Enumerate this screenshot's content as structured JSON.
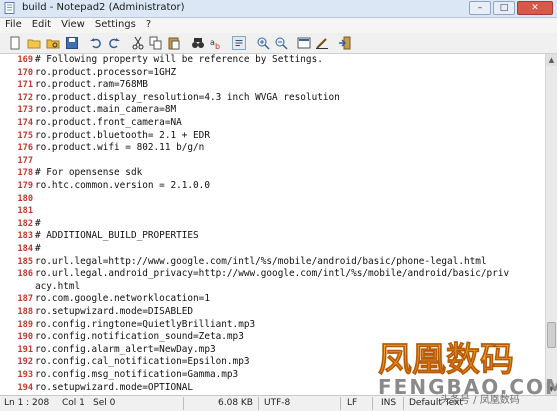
{
  "window": {
    "title": "build - Notepad2 (Administrator)",
    "min": "–",
    "max": "□",
    "close": "✕"
  },
  "menu": [
    "File",
    "Edit",
    "View",
    "Settings",
    "?"
  ],
  "toolbar": [
    "new-file-icon",
    "open-folder-icon",
    "browse-icon",
    "save-icon",
    "undo-icon",
    "redo-icon",
    "cut-icon",
    "copy-icon",
    "paste-icon",
    "find-icon",
    "replace-icon",
    "word-wrap-icon",
    "zoom-in-icon",
    "zoom-out-icon",
    "scheme-icon",
    "customize-icon",
    "exit-icon"
  ],
  "lines": [
    {
      "n": "169",
      "t": "# Following property will be reference by Settings."
    },
    {
      "n": "170",
      "t": "ro.product.processor=1GHZ"
    },
    {
      "n": "171",
      "t": "ro.product.ram=768MB"
    },
    {
      "n": "172",
      "t": "ro.product.display_resolution=4.3 inch WVGA resolution"
    },
    {
      "n": "173",
      "t": "ro.product.main_camera=8M"
    },
    {
      "n": "174",
      "t": "ro.product.front_camera=NA"
    },
    {
      "n": "175",
      "t": "ro.product.bluetooth= 2.1 + EDR"
    },
    {
      "n": "176",
      "t": "ro.product.wifi = 802.11 b/g/n"
    },
    {
      "n": "177",
      "t": ""
    },
    {
      "n": "178",
      "t": "# For opensense sdk"
    },
    {
      "n": "179",
      "t": "ro.htc.common.version = 2.1.0.0"
    },
    {
      "n": "180",
      "t": ""
    },
    {
      "n": "181",
      "t": ""
    },
    {
      "n": "182",
      "t": "#"
    },
    {
      "n": "183",
      "t": "# ADDITIONAL_BUILD_PROPERTIES"
    },
    {
      "n": "184",
      "t": "#"
    },
    {
      "n": "185",
      "t": "ro.url.legal=http://www.google.com/intl/%s/mobile/android/basic/phone-legal.html"
    },
    {
      "n": "186",
      "t": "ro.url.legal.android_privacy=http://www.google.com/intl/%s/mobile/android/basic/priv"
    },
    {
      "n": "",
      "t": "acy.html"
    },
    {
      "n": "187",
      "t": "ro.com.google.networklocation=1"
    },
    {
      "n": "188",
      "t": "ro.setupwizard.mode=DISABLED"
    },
    {
      "n": "189",
      "t": "ro.config.ringtone=QuietlyBrilliant.mp3"
    },
    {
      "n": "190",
      "t": "ro.config.notification_sound=Zeta.mp3"
    },
    {
      "n": "191",
      "t": "ro.config.alarm_alert=NewDay.mp3"
    },
    {
      "n": "192",
      "t": "ro.config.cal_notification=Epsilon.mp3"
    },
    {
      "n": "193",
      "t": "ro.config.msg_notification=Gamma.mp3"
    },
    {
      "n": "194",
      "t": "ro.setupwizard.mode=OPTIONAL"
    }
  ],
  "status": {
    "position": "Ln 1 : 208",
    "column": "Col 1",
    "selection": "Sel 0",
    "size": "6.08 KB",
    "encoding": "UTF-8",
    "eol": "LF",
    "ins": "INS",
    "scheme": "Default Text"
  },
  "watermark": {
    "logo": "凤凰数码",
    "url": "FENGBAO.COM",
    "caption": "头条号 / 凤凰数码"
  }
}
